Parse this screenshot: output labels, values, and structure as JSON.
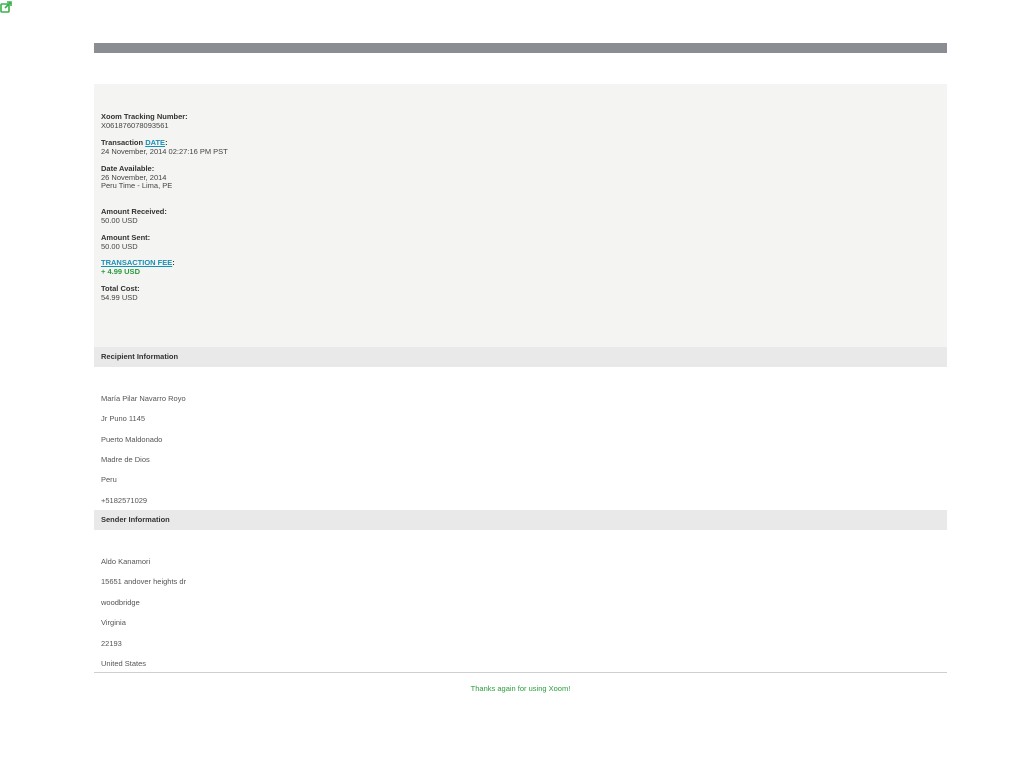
{
  "icons": {
    "external_link": "external-link-icon",
    "color": "#3ab04a"
  },
  "summary": {
    "tracking_label": "Xoom Tracking Number:",
    "tracking_value": "X061876078093561",
    "transaction_label": "Transaction ",
    "transaction_link": "DATE",
    "transaction_colon": ":",
    "transaction_value": "24 November, 2014 02:27:16 PM PST",
    "available_label": "Date Available:",
    "available_date": "26 November, 2014",
    "available_tz": "Peru Time - Lima, PE",
    "received_label": "Amount Received:",
    "received_value": "50.00 USD",
    "sent_label": "Amount Sent:",
    "sent_value": "50.00 USD",
    "fee_link": "TRANSACTION FEE",
    "fee_colon": ":",
    "fee_value": "+ 4.99 USD",
    "total_label": "Total Cost:",
    "total_value": "54.99 USD"
  },
  "recipient": {
    "header": "Recipient Information",
    "name": "María Pilar Navarro Royo",
    "street": "Jr Puno 1145",
    "city": "Puerto Maldonado",
    "region": "Madre de Dios",
    "country": "Peru",
    "phone": "+5182571029"
  },
  "sender": {
    "header": "Sender Information",
    "name": "Aldo Kanamori",
    "street": "15651 andover heights dr",
    "city": "woodbridge",
    "state": "Virginia",
    "zip": "22193",
    "country": "United States"
  },
  "footer": {
    "text": "Thanks again for using Xoom!"
  },
  "colors": {
    "bar": "#8a8d92",
    "link": "#1a8fb5",
    "fee": "#2a9c3c",
    "panel": "#f4f4f3",
    "header_bg": "#e9e9e9"
  }
}
